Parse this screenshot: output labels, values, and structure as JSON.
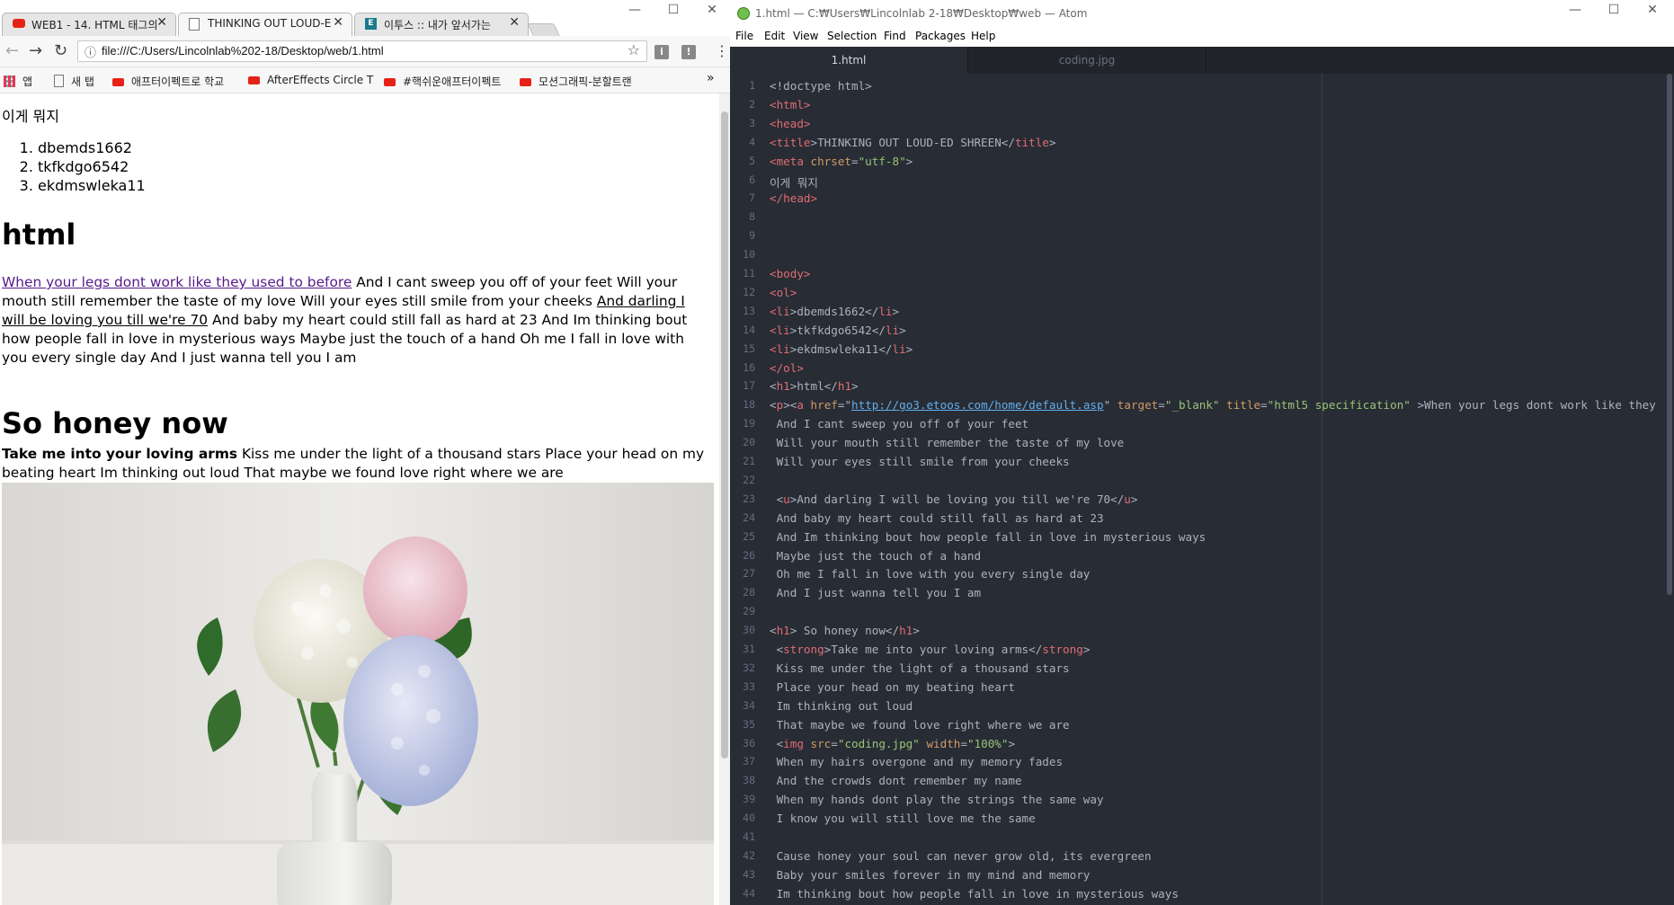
{
  "browser": {
    "tabs": [
      {
        "title": "WEB1 - 14. HTML 태그의",
        "icon": "youtube-icon",
        "active": false
      },
      {
        "title": "THINKING OUT LOUD-E",
        "icon": "page-icon",
        "active": true
      },
      {
        "title": "이투스 :: 내가 앞서가는",
        "icon": "etoos-icon",
        "active": false
      }
    ],
    "url": "file:///C:/Users/Lincolnlab%202-18/Desktop/web/1.html",
    "bookmarks": [
      {
        "label": "앱",
        "icon": "apps-grid-icon"
      },
      {
        "label": "새 탭",
        "icon": "page-icon"
      },
      {
        "label": "애프터이펙트로 학교",
        "icon": "youtube-icon"
      },
      {
        "label": "AfterEffects Circle T",
        "icon": "youtube-icon"
      },
      {
        "label": "#핵쉬운애프터이펙트",
        "icon": "youtube-icon"
      },
      {
        "label": "모션그래픽-분할트랜",
        "icon": "youtube-icon"
      }
    ],
    "more_bookmarks": "»",
    "page": {
      "head_text": "이게 뭐지",
      "list": [
        "dbemds1662",
        "tkfkdgo6542",
        "ekdmswleka11"
      ],
      "h1_first": "html",
      "link_text": "When your legs dont work like they used to before",
      "p1_after_link": " And I cant sweep you off of your feet Will your mouth still remember the taste of my love Will your eyes still smile from your cheeks ",
      "p1_underlined": "And darling I will be loving you till we're 70",
      "p1_end": " And baby my heart could still fall as hard at 23 And Im thinking bout how people fall in love in mysterious ways Maybe just the touch of a hand Oh me I fall in love with you every single day And I just wanna tell you I am",
      "h1_second": "So honey now",
      "p2_strong": "Take me into your loving arms",
      "p2_rest": " Kiss me under the light of a thousand stars Place your head on my beating heart Im thinking out loud That maybe we found love right where we are"
    }
  },
  "atom": {
    "window_title": "1.html — C:₩Users₩Lincolnlab 2-18₩Desktop₩web — Atom",
    "menu": [
      "File",
      "Edit",
      "View",
      "Selection",
      "Find",
      "Packages",
      "Help"
    ],
    "tabs": [
      {
        "label": "1.html",
        "active": true
      },
      {
        "label": "coding.jpg",
        "active": false
      }
    ],
    "lines": [
      [
        [
          "p",
          "<!doctype html>"
        ]
      ],
      [
        [
          "t",
          "<html>"
        ]
      ],
      [
        [
          "t",
          "<head>"
        ]
      ],
      [
        [
          "t",
          "<title"
        ],
        [
          "p",
          ">THINKING OUT LOUD-ED SHREEN</"
        ],
        [
          "t",
          "title"
        ],
        [
          "p",
          ">"
        ]
      ],
      [
        [
          "t",
          "<meta "
        ],
        [
          "a",
          "chrset"
        ],
        [
          "p",
          "="
        ],
        [
          "s",
          "\"utf-8\""
        ],
        [
          "p",
          ">"
        ]
      ],
      [
        [
          "p",
          "이게 뭐지"
        ]
      ],
      [
        [
          "t",
          "</head>"
        ]
      ],
      [],
      [],
      [],
      [
        [
          "t",
          "<body>"
        ]
      ],
      [
        [
          "t",
          "<ol>"
        ]
      ],
      [
        [
          "t",
          "<li"
        ],
        [
          "p",
          ">dbemds1662</"
        ],
        [
          "t",
          "li"
        ],
        [
          "p",
          ">"
        ]
      ],
      [
        [
          "t",
          "<li"
        ],
        [
          "p",
          ">tkfkdgo6542</"
        ],
        [
          "t",
          "li"
        ],
        [
          "p",
          ">"
        ]
      ],
      [
        [
          "t",
          "<li"
        ],
        [
          "p",
          ">ekdmswleka11</"
        ],
        [
          "t",
          "li"
        ],
        [
          "p",
          ">"
        ]
      ],
      [
        [
          "t",
          "</ol>"
        ]
      ],
      [
        [
          "p",
          "<"
        ],
        [
          "t",
          "h1"
        ],
        [
          "p",
          ">html</"
        ],
        [
          "t",
          "h1"
        ],
        [
          "p",
          ">"
        ]
      ],
      [
        [
          "p",
          "<"
        ],
        [
          "t",
          "p"
        ],
        [
          "p",
          "><"
        ],
        [
          "t",
          "a "
        ],
        [
          "a",
          "href"
        ],
        [
          "p",
          "=\""
        ],
        [
          "u",
          "http://go3.etoos.com/home/default.asp"
        ],
        [
          "p",
          "\" "
        ],
        [
          "a",
          "target"
        ],
        [
          "p",
          "="
        ],
        [
          "s",
          "\"_blank\""
        ],
        [
          "p",
          " "
        ],
        [
          "a",
          "title"
        ],
        [
          "p",
          "="
        ],
        [
          "s",
          "\"html5 specification\""
        ],
        [
          "p",
          " >When your legs dont work like they"
        ]
      ],
      [
        [
          "p",
          " And I cant sweep you off of your feet"
        ]
      ],
      [
        [
          "p",
          " Will your mouth still remember the taste of my love"
        ]
      ],
      [
        [
          "p",
          " Will your eyes still smile from your cheeks"
        ]
      ],
      [],
      [
        [
          "p",
          " <"
        ],
        [
          "t",
          "u"
        ],
        [
          "p",
          ">And darling I will be loving you till we're 70</"
        ],
        [
          "t",
          "u"
        ],
        [
          "p",
          ">"
        ]
      ],
      [
        [
          "p",
          " And baby my heart could still fall as hard at 23"
        ]
      ],
      [
        [
          "p",
          " And Im thinking bout how people fall in love in mysterious ways"
        ]
      ],
      [
        [
          "p",
          " Maybe just the touch of a hand"
        ]
      ],
      [
        [
          "p",
          " Oh me I fall in love with you every single day"
        ]
      ],
      [
        [
          "p",
          " And I just wanna tell you I am"
        ]
      ],
      [],
      [
        [
          "p",
          "<"
        ],
        [
          "t",
          "h1"
        ],
        [
          "p",
          "> So honey now</"
        ],
        [
          "t",
          "h1"
        ],
        [
          "p",
          ">"
        ]
      ],
      [
        [
          "p",
          " <"
        ],
        [
          "t",
          "strong"
        ],
        [
          "p",
          ">Take me into your loving arms</"
        ],
        [
          "t",
          "strong"
        ],
        [
          "p",
          ">"
        ]
      ],
      [
        [
          "p",
          " Kiss me under the light of a thousand stars"
        ]
      ],
      [
        [
          "p",
          " Place your head on my beating heart"
        ]
      ],
      [
        [
          "p",
          " Im thinking out loud"
        ]
      ],
      [
        [
          "p",
          " That maybe we found love right where we are"
        ]
      ],
      [
        [
          "p",
          " <"
        ],
        [
          "t",
          "img "
        ],
        [
          "a",
          "src"
        ],
        [
          "p",
          "="
        ],
        [
          "s",
          "\"coding.jpg\""
        ],
        [
          "p",
          " "
        ],
        [
          "a",
          "width"
        ],
        [
          "p",
          "="
        ],
        [
          "s",
          "\"100%\""
        ],
        [
          "p",
          ">"
        ]
      ],
      [
        [
          "p",
          " When my hairs overgone and my memory fades"
        ]
      ],
      [
        [
          "p",
          " And the crowds dont remember my name"
        ]
      ],
      [
        [
          "p",
          " When my hands dont play the strings the same way"
        ]
      ],
      [
        [
          "p",
          " I know you will still love me the same"
        ]
      ],
      [],
      [
        [
          "p",
          " Cause honey your soul can never grow old, its evergreen"
        ]
      ],
      [
        [
          "p",
          " Baby your smiles forever in my mind and memory"
        ]
      ],
      [
        [
          "p",
          " Im thinking bout how people fall in love in mysterious ways"
        ]
      ]
    ]
  },
  "colors": {
    "atom_bg": "#282c34",
    "tag": "#e06c75",
    "attr": "#d19a66",
    "string": "#98c379",
    "link": "#551a8b"
  }
}
